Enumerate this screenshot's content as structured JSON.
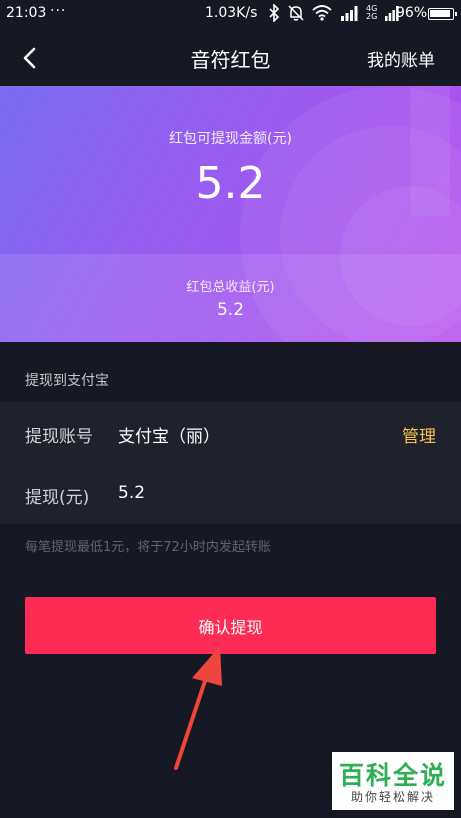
{
  "status_bar": {
    "time": "21:03",
    "menu_dots": "···",
    "net_speed": "1.03K/s",
    "net_4g": "4G",
    "net_2g": "2G",
    "battery_percent": "96%"
  },
  "nav": {
    "title": "音符红包",
    "bill_link": "我的账单"
  },
  "hero": {
    "balance_label": "红包可提现金额(元)",
    "balance_amount": "5.2",
    "total_label": "红包总收益(元)",
    "total_amount": "5.2"
  },
  "withdraw": {
    "section_title": "提现到支付宝",
    "account_label": "提现账号",
    "account_value": "支付宝（丽）",
    "manage_label": "管理",
    "amount_label": "提现(元)",
    "amount_value": "5.2",
    "hint": "每笔提现最低1元，将于72小时内发起转账",
    "confirm_label": "确认提现"
  },
  "watermark": {
    "title": "百科全说",
    "subtitle": "助你轻松解决"
  },
  "colors": {
    "background": "#161823",
    "panel": "#1f212c",
    "accent_button": "#fe2c55",
    "manage_link": "#f5c24b",
    "arrow": "#f0453f",
    "watermark_green": "#2eae55"
  }
}
